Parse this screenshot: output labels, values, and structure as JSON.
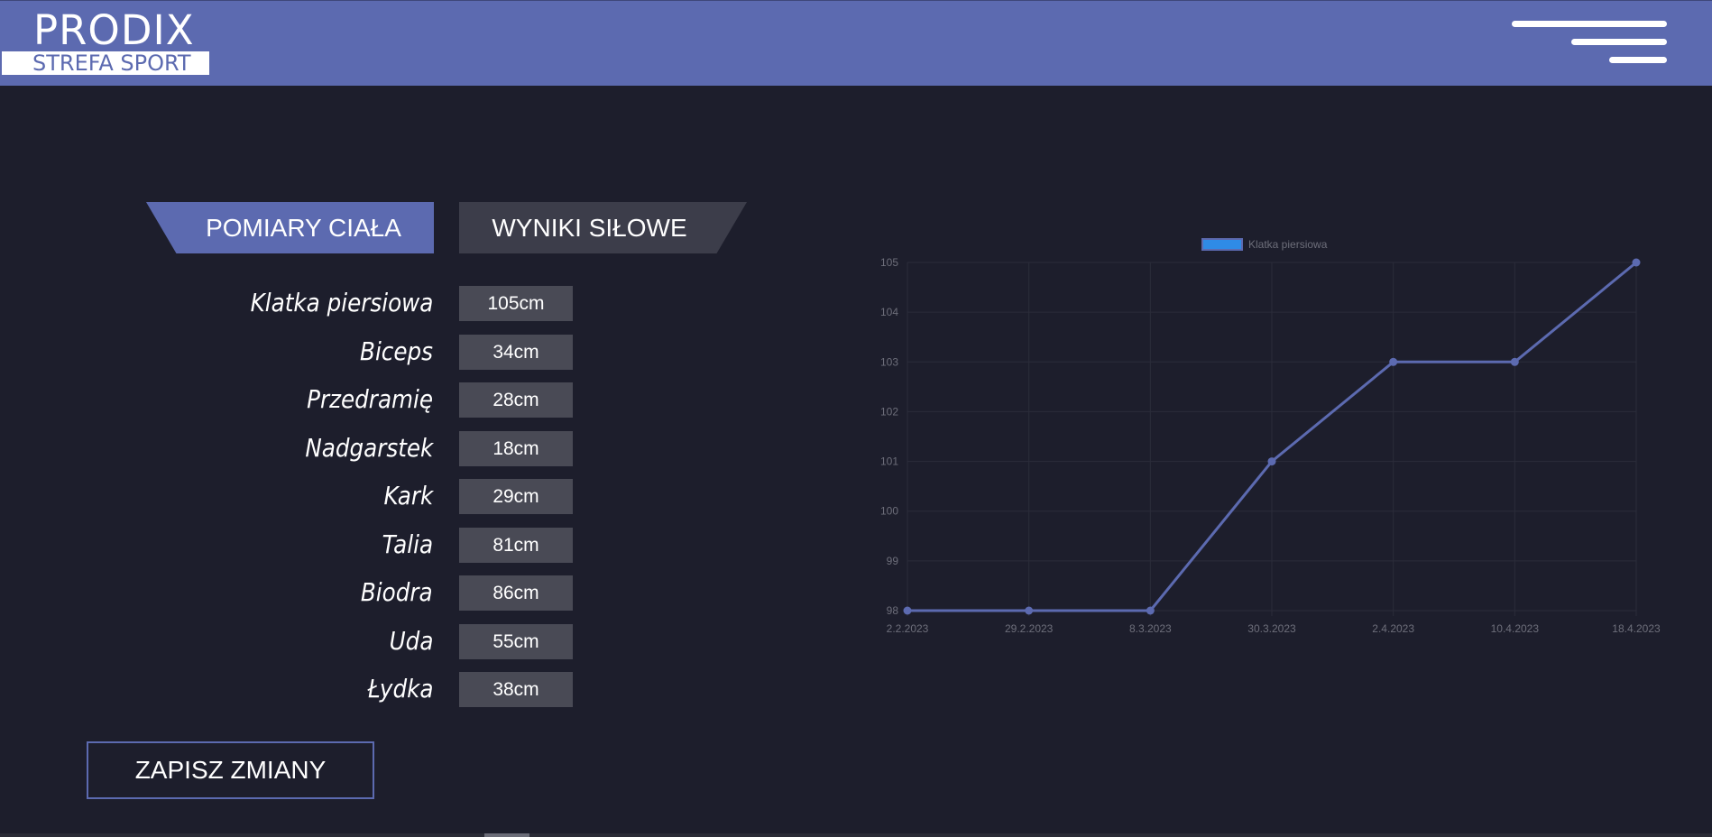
{
  "header": {
    "brand": "PRODIX",
    "tagline": "STREFA SPORT",
    "menu_icon": "hamburger-menu-icon"
  },
  "tabs": [
    {
      "label": "POMIARY CIAŁA",
      "active": true
    },
    {
      "label": "WYNIKI SIŁOWE",
      "active": false
    }
  ],
  "measurements": [
    {
      "label": "Klatka piersiowa",
      "value": "105cm"
    },
    {
      "label": "Biceps",
      "value": "34cm"
    },
    {
      "label": "Przedramię",
      "value": "28cm"
    },
    {
      "label": "Nadgarstek",
      "value": "18cm"
    },
    {
      "label": "Kark",
      "value": "29cm"
    },
    {
      "label": "Talia",
      "value": "81cm"
    },
    {
      "label": "Biodra",
      "value": "86cm"
    },
    {
      "label": "Uda",
      "value": "55cm"
    },
    {
      "label": "Łydka",
      "value": "38cm"
    }
  ],
  "save_button": "ZAPISZ ZMIANY",
  "colors": {
    "accent": "#5c6ab0",
    "background": "#1d1e2c",
    "field": "#494a55",
    "legend_swatch": "#2f8be6"
  },
  "chart_data": {
    "type": "line",
    "categories": [
      "2.2.2023",
      "29.2.2023",
      "8.3.2023",
      "30.3.2023",
      "2.4.2023",
      "10.4.2023",
      "18.4.2023"
    ],
    "series": [
      {
        "name": "Klatka piersiowa",
        "values": [
          98,
          98,
          98,
          101,
          103,
          103,
          105
        ]
      }
    ],
    "ylim": [
      98,
      105
    ],
    "yticks": [
      "98",
      "99",
      "100",
      "101",
      "102",
      "103",
      "104",
      "105"
    ],
    "grid": true,
    "legend": "top"
  }
}
